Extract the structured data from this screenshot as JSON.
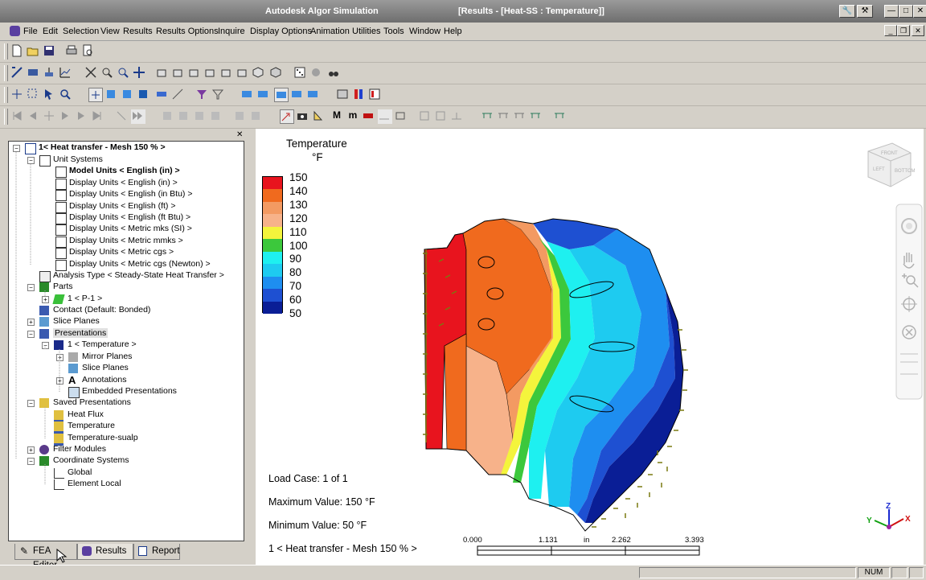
{
  "window": {
    "app_title": "Autodesk Algor Simulation",
    "doc_title": "[Results - [Heat-SS : Temperature]]"
  },
  "menu": [
    "File",
    "Edit",
    "Selection",
    "View",
    "Results",
    "Results Options",
    "Inquire",
    "Display Options",
    "Animation",
    "Utilities",
    "Tools",
    "Window",
    "Help"
  ],
  "tree": {
    "root": "1< Heat transfer - Mesh 150 % >",
    "unit_systems": "Unit Systems",
    "model_units": "Model Units < English (in) >",
    "display_units": [
      "Display Units < English (in) >",
      "Display Units < English (in Btu) >",
      "Display Units < English (ft) >",
      "Display Units < English (ft Btu) >",
      "Display Units < Metric mks (SI) >",
      "Display Units < Metric mmks >",
      "Display Units < Metric cgs >",
      "Display Units < Metric cgs (Newton) >"
    ],
    "analysis_type": "Analysis Type < Steady-State Heat Transfer >",
    "parts": "Parts",
    "part1": "1 < P-1 >",
    "contact": "Contact (Default: Bonded)",
    "slice_planes": "Slice Planes",
    "presentations": "Presentations",
    "pres1": "1 < Temperature >",
    "mirror_planes": "Mirror Planes",
    "pres_slice_planes": "Slice Planes",
    "annotations": "Annotations",
    "embedded": "Embedded Presentations",
    "saved_presentations": "Saved Presentations",
    "saved": [
      "Heat Flux",
      "Temperature",
      "Temperature-sualp"
    ],
    "filter_modules": "Filter Modules",
    "coord_systems": "Coordinate Systems",
    "global": "Global",
    "element_local": "Element Local"
  },
  "tabs": {
    "fea_editor": "FEA Editor",
    "results": "Results",
    "report": "Report"
  },
  "legend": {
    "title": "Temperature",
    "unit": "°F",
    "values": [
      "150",
      "140",
      "130",
      "120",
      "110",
      "100",
      "90",
      "80",
      "70",
      "60",
      "50"
    ],
    "colors": [
      "#e8141e",
      "#f06a1e",
      "#f39a62",
      "#f7b28a",
      "#f4f43c",
      "#3cc83c",
      "#1ef0f0",
      "#1ecbf0",
      "#1e8ef0",
      "#1e50d2",
      "#0a1e96"
    ]
  },
  "info": {
    "load_case": "Load Case:   1 of 1",
    "max_value": "Maximum Value: 150 °F",
    "min_value": "Minimum Value: 50 °F",
    "model_name": "1 < Heat transfer - Mesh 150 % >"
  },
  "scale_bar": {
    "labels": [
      "0.000",
      "1.131",
      "2.262",
      "3.393"
    ],
    "unit": "in"
  },
  "viewcube": {
    "front": "FRONT",
    "left": "LEFT",
    "bottom": "BOTTOM"
  },
  "triad": {
    "x": "X",
    "y": "Y",
    "z": "Z"
  },
  "status": {
    "num": "NUM"
  }
}
